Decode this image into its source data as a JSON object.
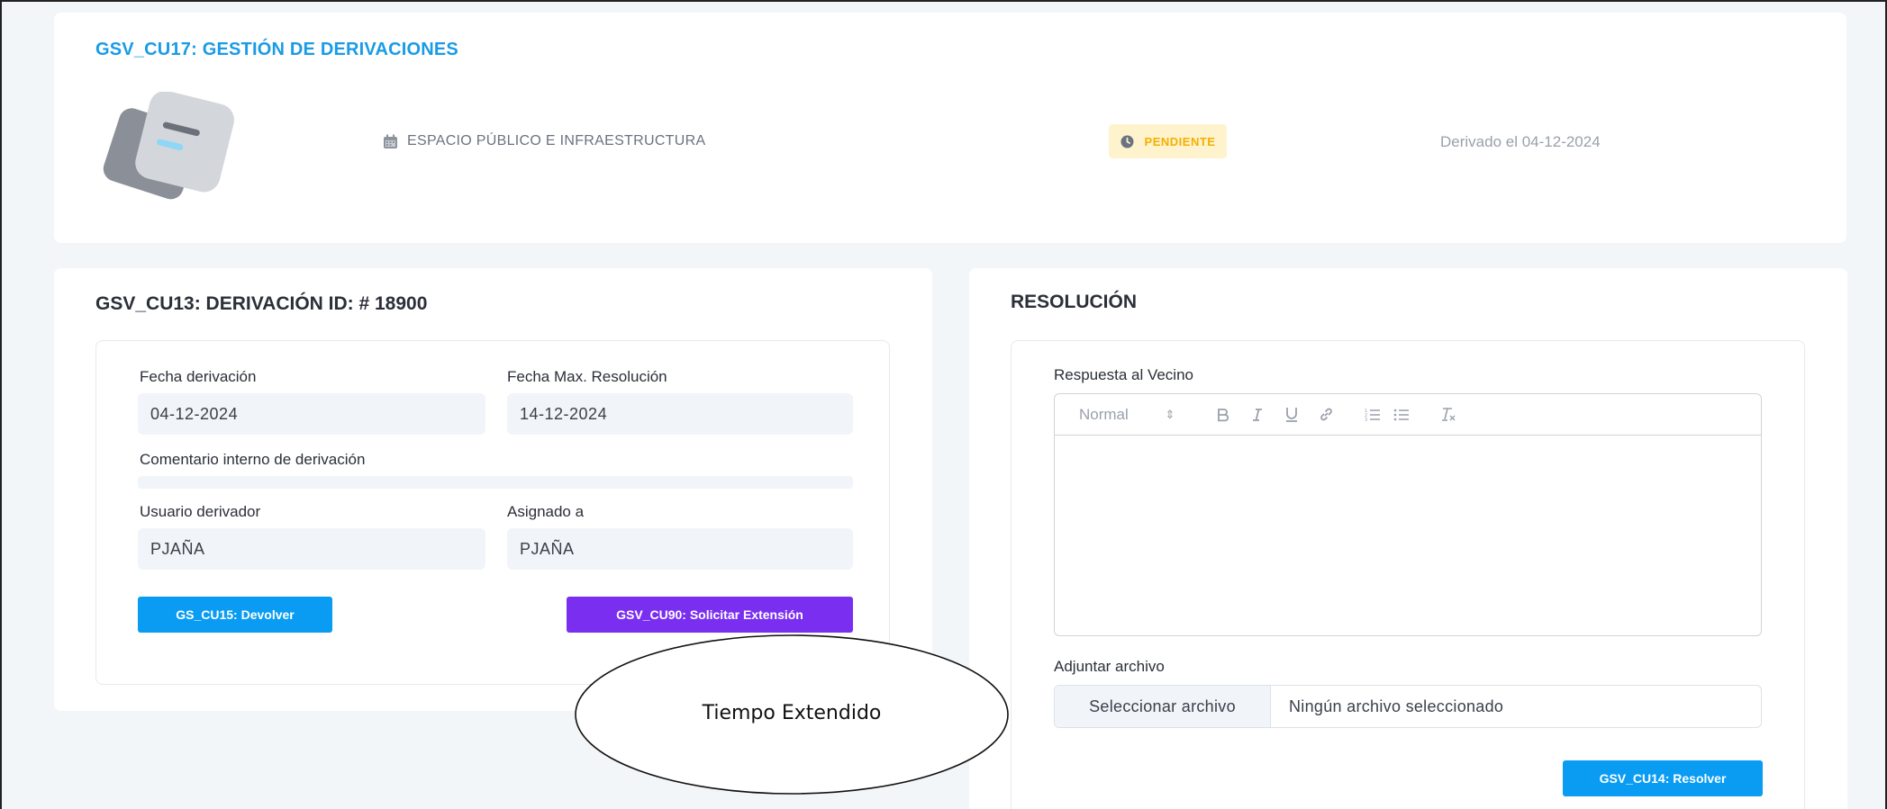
{
  "header": {
    "title": "GSV_CU17: GESTIÓN DE DERIVACIONES",
    "category": "ESPACIO PÚBLICO E INFRAESTRUCTURA",
    "category_icon": "calendar-icon",
    "status": "PENDIENTE",
    "status_icon": "clock-icon",
    "derived_text": "Derivado el 04-12-2024"
  },
  "derivation": {
    "title": "GSV_CU13: DERIVACIÓN ID: # 18900",
    "fecha_derivacion_label": "Fecha derivación",
    "fecha_derivacion_value": "04-12-2024",
    "fecha_max_label": "Fecha Max. Resolución",
    "fecha_max_value": "14-12-2024",
    "comentario_label": "Comentario interno de derivación",
    "usuario_label": "Usuario derivador",
    "usuario_value": "PJAÑA",
    "asignado_label": "Asignado a",
    "asignado_value": "PJAÑA",
    "devolver_button": "GS_CU15: Devolver",
    "extension_button": "GSV_CU90: Solicitar Extensión"
  },
  "resolution": {
    "title": "RESOLUCIÓN",
    "respuesta_label": "Respuesta al Vecino",
    "toolbar": {
      "format_select": "Normal",
      "icons": [
        "bold-icon",
        "italic-icon",
        "underline-icon",
        "link-icon",
        "ordered-list-icon",
        "bullet-list-icon",
        "clear-format-icon"
      ]
    },
    "adjuntar_label": "Adjuntar archivo",
    "file_button": "Seleccionar archivo",
    "file_status": "Ningún archivo seleccionado",
    "resolver_button": "GSV_CU14: Resolver"
  },
  "annotation": {
    "text": "Tiempo Extendido"
  },
  "colors": {
    "accent_blue": "#0a9cf3",
    "purple": "#7a2ff0",
    "title_blue": "#1a9be6",
    "pending_bg": "#fff3cd",
    "pending_text": "#f2b100"
  }
}
